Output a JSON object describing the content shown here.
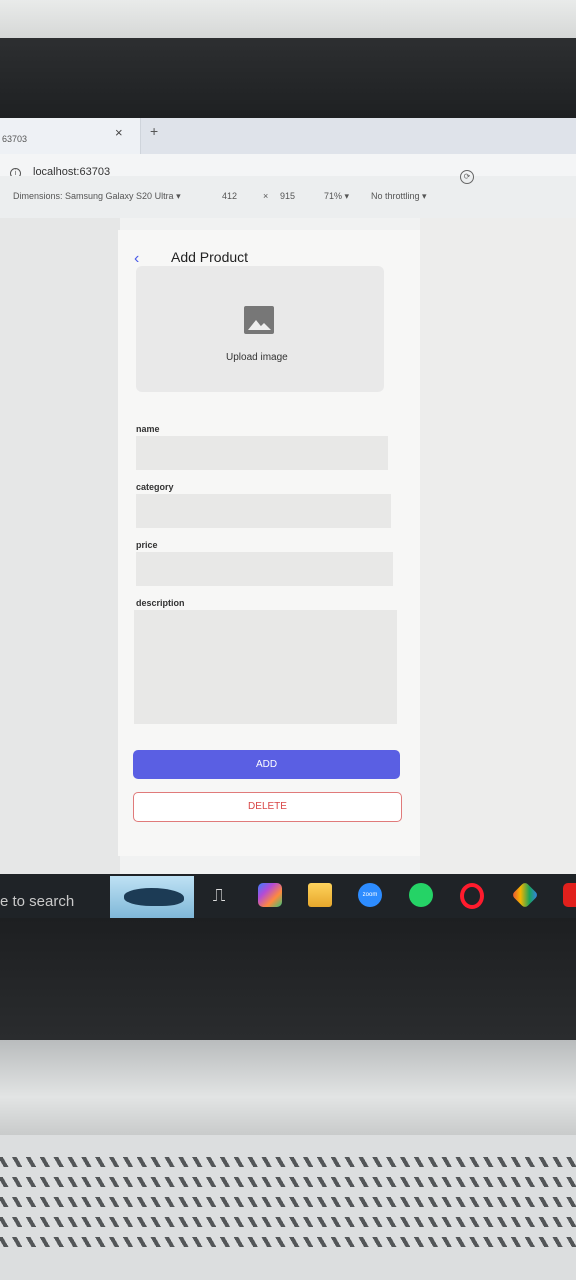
{
  "browser": {
    "tab_title": "63703",
    "tab_close": "×",
    "new_tab": "+",
    "url": "localhost:63703"
  },
  "devtools": {
    "dimensions_label": "Dimensions: Samsung Galaxy S20 Ultra ▾",
    "width": "412",
    "times": "×",
    "height": "915",
    "zoom": "71% ▾",
    "throttling": "No throttling ▾"
  },
  "app": {
    "back_icon": "‹",
    "title": "Add Product",
    "upload_label": "Upload image",
    "fields": {
      "name": "name",
      "category": "category",
      "price": "price",
      "description": "description"
    },
    "add_button": "ADD",
    "delete_button": "DELETE",
    "colors": {
      "primary": "#5a5fe3",
      "danger": "#d84545"
    }
  },
  "taskbar": {
    "search_text": "e to search",
    "zoom_label": "zoom",
    "icons": [
      "dolphin-wallpaper-icon",
      "task-view-icon",
      "copilot-icon",
      "file-explorer-icon",
      "zoom-icon",
      "whatsapp-icon",
      "opera-icon",
      "git-icon",
      "acrobat-icon"
    ]
  }
}
